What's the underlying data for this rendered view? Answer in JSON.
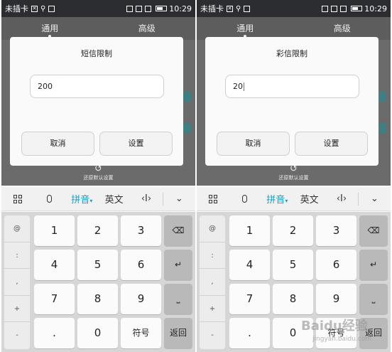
{
  "status_bar": {
    "carrier": "未插卡",
    "time": "10:29"
  },
  "tabs": [
    "通用",
    "高级"
  ],
  "restore_label": "还原默认设置",
  "panels": [
    {
      "dialog_title": "短信限制",
      "input_value": "200",
      "cancel_label": "取消",
      "ok_label": "设置"
    },
    {
      "dialog_title": "彩信限制",
      "input_value": "20",
      "cancel_label": "取消",
      "ok_label": "设置"
    }
  ],
  "keyboard": {
    "toolbar": {
      "pinyin": "拼音",
      "english": "英文"
    },
    "symbols": [
      "@",
      ":",
      ",",
      "+",
      "-"
    ],
    "keys": [
      "1",
      "2",
      "3",
      "4",
      "5",
      "6",
      "7",
      "8",
      "9",
      ".",
      "0"
    ],
    "fuhao": "符号",
    "return": "返回"
  },
  "watermark": {
    "main": "Baidu经验",
    "sub": "jingyan.baidu.com"
  }
}
